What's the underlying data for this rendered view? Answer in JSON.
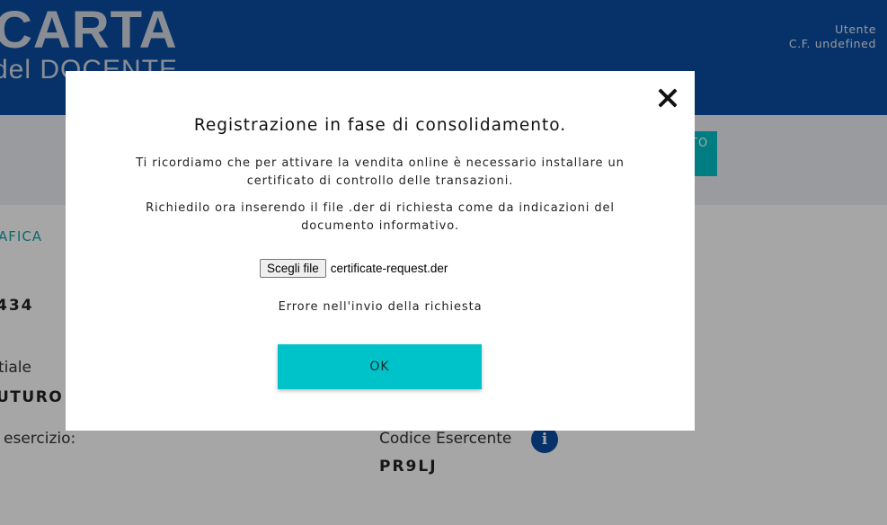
{
  "header": {
    "logo_main": "CARTA",
    "logo_sub": "del DOCENTE",
    "user_label": "Utente",
    "user_cf": "C.F. undefined"
  },
  "background": {
    "tab_label": "TO",
    "section_link": "AFICA",
    "number_value": "434",
    "field1_label": "tiale",
    "field1_value": "UTURO S",
    "field2_label": "esercizio:",
    "field3_label": "Codice Esercente",
    "field3_value": "PR9LJ",
    "info_icon": "info-icon"
  },
  "modal": {
    "title": "Registrazione in fase di consolidamento.",
    "paragraph1": "Ti ricordiamo che per attivare la vendita online è necessario installare un certificato di controllo delle transazioni.",
    "paragraph2": "Richiedilo ora inserendo il file .der di richiesta come da indicazioni del documento informativo.",
    "file_button": "Scegli file",
    "file_name": "certificate-request.der",
    "error_message": "Errore nell'invio della richiesta",
    "ok_button": "OK",
    "close_icon": "close-icon"
  },
  "colors": {
    "header_bg": "#0b4ea2",
    "accent_teal": "#00c2c9",
    "link_teal": "#17a1a8"
  }
}
